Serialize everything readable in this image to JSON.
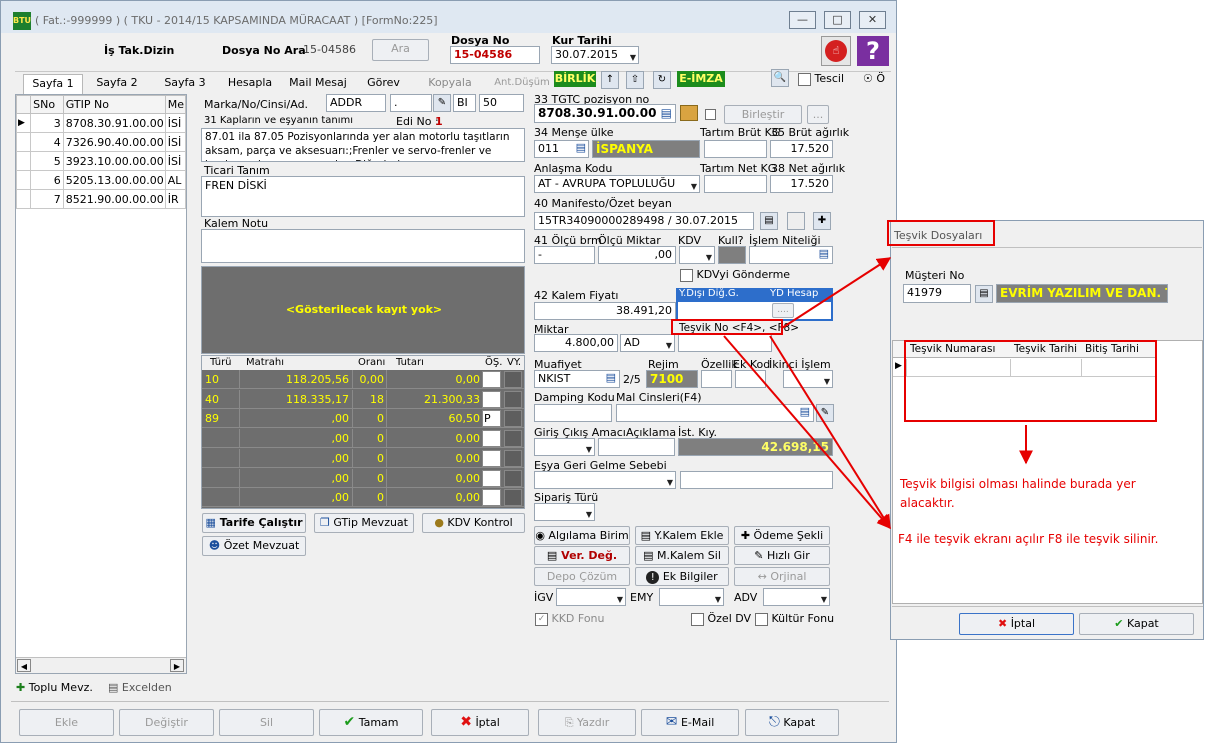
{
  "window": {
    "title": "( Fat.:-999999 ) ( TKU - 2014/15 KAPSAMINDA MÜRACAAT ) [FormNo:225]",
    "app_icon_text": "BTU"
  },
  "header": {
    "is_takip_dizin": "İş Tak.Dizin",
    "dosya_no_ara_label": "Dosya No Ara",
    "dosya_no_ara_value": "15-04586",
    "ara_button": "Ara",
    "dosya_no_label": "Dosya No",
    "dosya_no_value": "15-04586",
    "kur_tarihi_label": "Kur Tarihi",
    "kur_tarihi_value": "30.07.2015"
  },
  "tabs": [
    "Sayfa 1",
    "Sayfa 2",
    "Sayfa 3",
    "Hesapla",
    "Mail Mesaj",
    "Görev",
    "Kopyala",
    "Ant.Düşüm"
  ],
  "toolbar": {
    "birlik": "BİRLİK",
    "eimza": "E-İMZA",
    "tescil": "Tescil",
    "o_label": "Ö"
  },
  "left_table": {
    "headers": [
      "SNo",
      "GTIP No",
      "Me"
    ],
    "rows": [
      {
        "sno": "3",
        "gtip": "8708.30.91.00.00",
        "me": "İSİ"
      },
      {
        "sno": "4",
        "gtip": "7326.90.40.00.00",
        "me": "İSİ"
      },
      {
        "sno": "5",
        "gtip": "3923.10.00.00.00",
        "me": "İSİ"
      },
      {
        "sno": "6",
        "gtip": "5205.13.00.00.00",
        "me": "AL"
      },
      {
        "sno": "7",
        "gtip": "8521.90.00.00.00",
        "me": "İR"
      }
    ],
    "toplu_mevz": "Toplu Mevz.",
    "excelden": "Excelden"
  },
  "middle": {
    "marka_label": "Marka/No/Cinsi/Ad.",
    "marka_value": "ADDR",
    "marka_small": ".",
    "bi_value": "BI",
    "num_value": "50",
    "kaplar_label": "31 Kapların ve eşyanın tanımı",
    "edi_label": "Edi No :",
    "edi_value": "1",
    "description": "87.01 ila 87.05 Pozisyonlarında yer alan motorlu taşıtların aksam, parça ve aksesuarı:;Frenler ve servo-frenler ve bunların aksam ve parçaları;Diğerleri",
    "ticari_tanim_label": "Ticari Tanım",
    "ticari_tanim_value": "FREN DİSKİ",
    "kalem_notu_label": "Kalem Notu",
    "empty_text": "<Gösterilecek kayıt yok>",
    "tax_headers": [
      "Türü",
      "Matrahı",
      "Oranı",
      "Tutarı",
      "ÖŞ.",
      "VY."
    ],
    "tax_rows": [
      {
        "turu": "10",
        "matrah": "118.205,56",
        "oran": "0,00",
        "tutar": "0,00",
        "os": ""
      },
      {
        "turu": "40",
        "matrah": "118.335,17",
        "oran": "18",
        "tutar": "21.300,33",
        "os": ""
      },
      {
        "turu": "89",
        "matrah": ",00",
        "oran": "0",
        "tutar": "60,50",
        "os": "P"
      },
      {
        "turu": "",
        "matrah": ",00",
        "oran": "0",
        "tutar": "0,00",
        "os": ""
      },
      {
        "turu": "",
        "matrah": ",00",
        "oran": "0",
        "tutar": "0,00",
        "os": ""
      },
      {
        "turu": "",
        "matrah": ",00",
        "oran": "0",
        "tutar": "0,00",
        "os": ""
      },
      {
        "turu": "",
        "matrah": ",00",
        "oran": "0",
        "tutar": "0,00",
        "os": ""
      }
    ],
    "tarife_calistir": "Tarife Çalıştır",
    "gtip_mevzuat": "GTip Mevzuat",
    "kdv_kontrol": "KDV Kontrol",
    "ozet_mevzuat": "Özet Mevzuat"
  },
  "right": {
    "gtip_label": "33 TGTC pozisyon no",
    "gtip_value": "8708.30.91.00.00",
    "birlestir": "Birleştir",
    "mense_label": "34 Menşe ülke",
    "mense_code": "011",
    "mense_name": "İSPANYA",
    "tartim_brut_label": "Tartım Brüt KG",
    "brut_label": "35 Brüt ağırlık",
    "brut_value": "17.520",
    "anlasma_label": "Anlaşma Kodu",
    "anlasma_value": "AT    - AVRUPA TOPLULUĞU",
    "tartim_net_label": "Tartım Net KG",
    "net_label": "38 Net ağırlık",
    "net_value": "17.520",
    "manifesto_label": "40 Manifesto/Özet beyan",
    "manifesto_value": "15TR34090000289498 / 30.07.2015",
    "olcu_label": "41 Ölçü brm",
    "olcu_miktar_label": "Ölçü Miktar",
    "kdv_label": "KDV",
    "kull_label": "Kull?",
    "islem_label": "İşlem Niteliği",
    "olcu_value": "-",
    "olcu_miktar_value": ",00",
    "kdv_gonderme": "KDVyi Gönderme",
    "kalem_fiyati_label": "42 Kalem Fiyatı",
    "kalem_fiyati_value": "38.491,20",
    "yd_dig_label": "Y.Dışı Diğ.G.",
    "yd_hesap_label": "YD Hesap",
    "miktar_label": "Miktar",
    "miktar_value": "4.800,00",
    "miktar_unit": "AD",
    "tesvik_label": "Teşvik No <F4>, <F8>",
    "muafiyet_label": "Muafiyet",
    "muafiyet_value": "NKIST",
    "muafiyet_extra": "2/5",
    "rejim_label": "Rejim",
    "rejim_value": "7100",
    "ozellik_label": "Özellik",
    "ek_kod_label": "Ek Kod",
    "ikinci_islem_label": "İkinci İşlem",
    "damping_label": "Damping Kodu",
    "mal_cinsleri_label": "Mal Cinsleri(F4)",
    "giris_cikis_label": "Giriş Çıkış Amacı",
    "aciklama_label": "Açıklama",
    "ist_kiy_label": "İst. Kıy.",
    "ist_kiy_value": "42.698,15",
    "esya_geri_label": "Eşya Geri Gelme Sebebi",
    "siparis_label": "Sipariş Türü",
    "btn_algilama": "Algılama Birim",
    "btn_ykalem": "Y.Kalem Ekle",
    "btn_odeme": "Ödeme Şekli",
    "btn_verdeg": "Ver. Değ.",
    "btn_mkalem": "M.Kalem Sil",
    "btn_hizli": "Hızlı Gir",
    "btn_depo": "Depo Çözüm",
    "btn_ekbilgi": "Ek Bilgiler",
    "btn_orjinal": "Orjinal",
    "igv_label": "İGV",
    "emy_label": "EMY",
    "adv_label": "ADV",
    "kkd_fonu": "KKD Fonu",
    "ozel_dv": "Özel DV",
    "kultur_fonu": "Kültür Fonu"
  },
  "bottom": {
    "ekle": "Ekle",
    "degistir": "Değiştir",
    "sil": "Sil",
    "tamam": "Tamam",
    "iptal": "İptal",
    "yazdir": "Yazdır",
    "email": "E-Mail",
    "kapat": "Kapat"
  },
  "dialog": {
    "title": "Teşvik Dosyaları",
    "musteri_no_label": "Müşteri No",
    "musteri_no_value": "41979",
    "musteri_name": "EVRİM YAZILIM VE DAN. TİC",
    "headers": [
      "Teşvik Numarası",
      "Teşvik Tarihi",
      "Bitiş Tarihi"
    ],
    "iptal": "İptal",
    "kapat": "Kapat"
  },
  "annotations": {
    "note1": "Teşvik bilgisi olması halinde burada yer alacaktır.",
    "note2": "F4 ile teşvik ekranı açılır F8 ile teşvik silinir.",
    "color": "#e60000"
  }
}
